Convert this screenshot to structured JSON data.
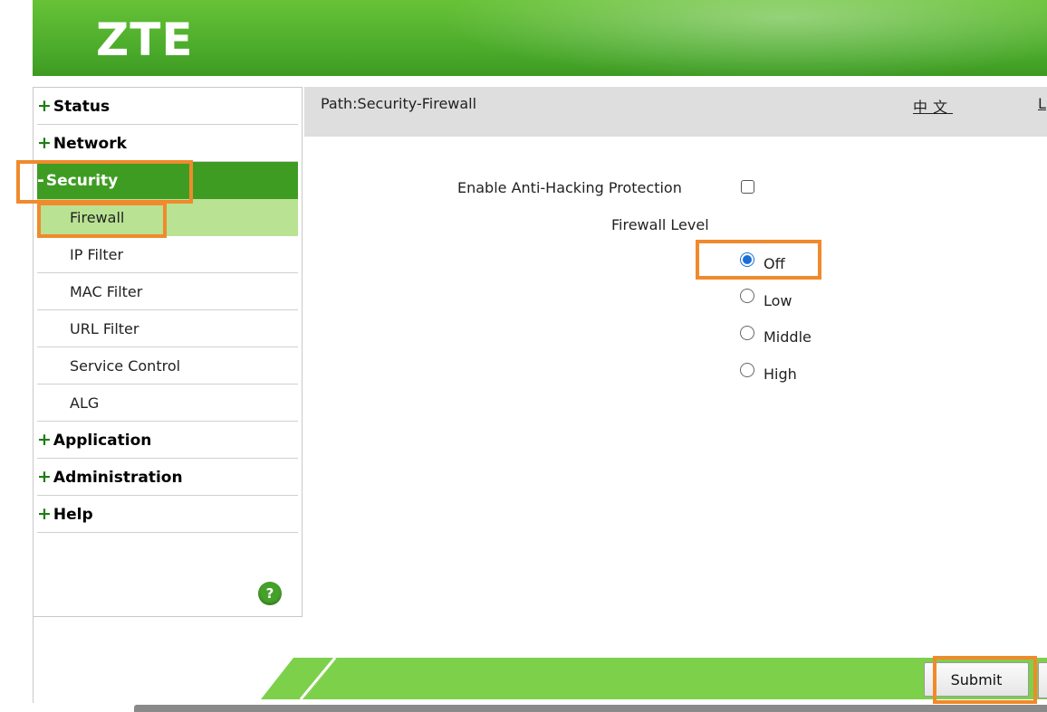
{
  "header": {
    "logo": "ZTE"
  },
  "sidebar": {
    "items": [
      {
        "sign": "+",
        "label": "Status"
      },
      {
        "sign": "+",
        "label": "Network"
      },
      {
        "sign": "-",
        "label": "Security"
      },
      {
        "sign": "+",
        "label": "Application"
      },
      {
        "sign": "+",
        "label": "Administration"
      },
      {
        "sign": "+",
        "label": "Help"
      }
    ],
    "security_subitems": [
      {
        "label": "Firewall"
      },
      {
        "label": "IP Filter"
      },
      {
        "label": "MAC Filter"
      },
      {
        "label": "URL Filter"
      },
      {
        "label": "Service Control"
      },
      {
        "label": "ALG"
      }
    ],
    "selected": "Firewall",
    "help_icon": "?"
  },
  "path_bar": {
    "path": "Path:Security-Firewall",
    "language": "中文",
    "logout_partial": "L"
  },
  "form": {
    "anti_hacking_label": "Enable Anti-Hacking Protection",
    "anti_hacking_checked": false,
    "firewall_level_label": "Firewall Level",
    "levels": [
      {
        "label": "Off",
        "checked": true
      },
      {
        "label": "Low",
        "checked": false
      },
      {
        "label": "Middle",
        "checked": false
      },
      {
        "label": "High",
        "checked": false
      }
    ]
  },
  "footer": {
    "submit_label": "Submit"
  },
  "colors": {
    "brand_green": "#49a92a",
    "active_menu": "#3f9c23",
    "selected_submenu": "#b9e293",
    "highlight": "#f08a2c",
    "footer_green": "#7dd04a"
  }
}
